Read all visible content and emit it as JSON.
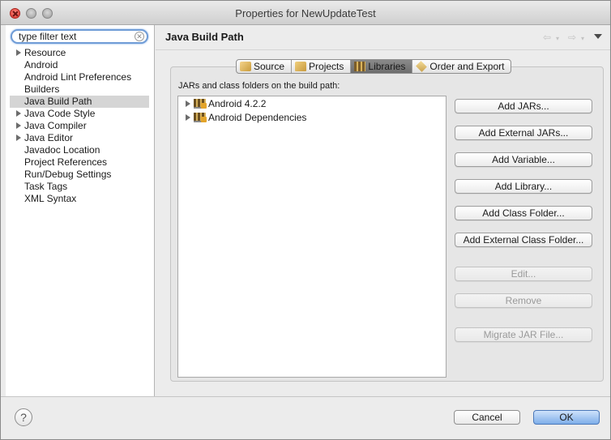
{
  "window": {
    "title": "Properties for NewUpdateTest"
  },
  "filter": {
    "value": "type filter text"
  },
  "tree": [
    {
      "label": "Resource",
      "expandable": true,
      "selected": false
    },
    {
      "label": "Android",
      "expandable": false,
      "selected": false
    },
    {
      "label": "Android Lint Preferences",
      "expandable": false,
      "selected": false
    },
    {
      "label": "Builders",
      "expandable": false,
      "selected": false
    },
    {
      "label": "Java Build Path",
      "expandable": false,
      "selected": true
    },
    {
      "label": "Java Code Style",
      "expandable": true,
      "selected": false
    },
    {
      "label": "Java Compiler",
      "expandable": true,
      "selected": false
    },
    {
      "label": "Java Editor",
      "expandable": true,
      "selected": false
    },
    {
      "label": "Javadoc Location",
      "expandable": false,
      "selected": false
    },
    {
      "label": "Project References",
      "expandable": false,
      "selected": false
    },
    {
      "label": "Run/Debug Settings",
      "expandable": false,
      "selected": false
    },
    {
      "label": "Task Tags",
      "expandable": false,
      "selected": false
    },
    {
      "label": "XML Syntax",
      "expandable": false,
      "selected": false
    }
  ],
  "page": {
    "title": "Java Build Path"
  },
  "nav": {
    "back": "⇦",
    "forward": "⇨",
    "dropdown": "▾"
  },
  "tabs": [
    {
      "label": "Source",
      "icon": "source-folder-icon",
      "active": false
    },
    {
      "label": "Projects",
      "icon": "projects-folder-icon",
      "active": false
    },
    {
      "label": "Libraries",
      "icon": "libraries-icon",
      "active": true
    },
    {
      "label": "Order and Export",
      "icon": "order-export-icon",
      "active": false
    }
  ],
  "libraries": {
    "label": "JARs and class folders on the build path:",
    "items": [
      {
        "label": "Android 4.2.2",
        "icon": "jar-library-icon"
      },
      {
        "label": "Android Dependencies",
        "icon": "jar-library-icon"
      }
    ]
  },
  "buttons": [
    {
      "label": "Add JARs...",
      "enabled": true
    },
    {
      "label": "Add External JARs...",
      "enabled": true
    },
    {
      "label": "Add Variable...",
      "enabled": true
    },
    {
      "label": "Add Library...",
      "enabled": true
    },
    {
      "label": "Add Class Folder...",
      "enabled": true
    },
    {
      "label": "Add External Class Folder...",
      "enabled": true
    },
    {
      "label": "Edit...",
      "enabled": false
    },
    {
      "label": "Remove",
      "enabled": false
    },
    {
      "label": "Migrate JAR File...",
      "enabled": false
    }
  ],
  "dialog": {
    "help": "?",
    "cancel": "Cancel",
    "ok": "OK"
  }
}
